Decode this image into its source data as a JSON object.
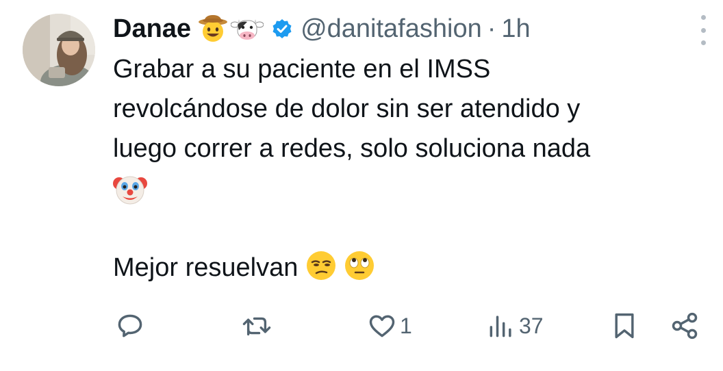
{
  "author": {
    "name": "Danae",
    "name_emojis": [
      "cowboy-hat-face",
      "cow-face"
    ],
    "verified": true,
    "handle": "@danitafashion",
    "separator": "·",
    "time": "1h"
  },
  "tweet": {
    "lines": [
      "Grabar a su paciente en el IMSS",
      "revolcándose de dolor sin ser atendido y",
      "luego correr a redes, solo soluciona nada"
    ],
    "clown_emoji": "clown-face",
    "last_line": "Mejor resuelvan",
    "last_line_emojis": [
      "unamused-face",
      "face-with-rolling-eyes"
    ]
  },
  "actions": {
    "reply": {
      "icon": "reply-icon",
      "count": ""
    },
    "retweet": {
      "icon": "retweet-icon",
      "count": ""
    },
    "like": {
      "icon": "heart-icon",
      "count": "1"
    },
    "views": {
      "icon": "views-icon",
      "count": "37"
    },
    "bookmark": {
      "icon": "bookmark-icon"
    },
    "share": {
      "icon": "share-icon"
    }
  },
  "colors": {
    "text": "#0f1419",
    "muted": "#536471",
    "verified_blue": "#1d9bf0"
  }
}
